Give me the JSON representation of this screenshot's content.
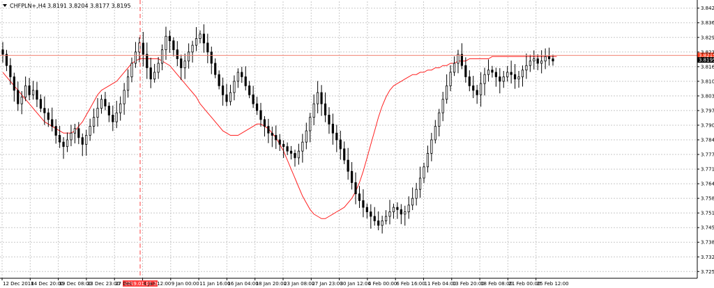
{
  "header": {
    "symbol": "CHFPLN+,H4",
    "ohlc": "3.8191 3.8204 3.8177 3.8195"
  },
  "colors": {
    "background": "#ffffff",
    "grid": "#c8c8c8",
    "candle": "#000000",
    "ma_line": "#ff2020",
    "level_line": "#f08070",
    "vline": "#ff4040",
    "level_tag": "#ff3a1a",
    "price_tag": "#000000"
  },
  "level_label": "3.8215",
  "current_price_label": "3.8195",
  "cursor_time_label": "2019.01.01 20:00",
  "chart_data": {
    "type": "candlestick",
    "title": "CHFPLN+,H4",
    "grid": true,
    "ylim": [
      3.7225,
      3.8455
    ],
    "y_ticks": [
      "3.8425",
      "3.8360",
      "3.8295",
      "3.8230",
      "3.8165",
      "3.8100",
      "3.8035",
      "3.7970",
      "3.7905",
      "3.7840",
      "3.7775",
      "3.7710",
      "3.7645",
      "3.7580",
      "3.7515",
      "3.7450",
      "3.7385",
      "3.7320",
      "3.7255"
    ],
    "x_ticks": [
      "12 Dec 2018",
      "14 Dec 20:00",
      "19 Dec 08:00",
      "23 Dec 23:00",
      "27 Dec",
      "4 Jan 12:00",
      "9 Jan 00:00",
      "11 Jan 16:00",
      "16 Jan 04:00",
      "18 Jan 20:00",
      "23 Jan 08:00",
      "27 Jan 23:00",
      "30 Jan 12:00",
      "4 Feb 00:00",
      "6 Feb 16:00",
      "11 Feb 04:00",
      "13 Feb 20:00",
      "18 Feb 08:00",
      "21 Feb 00:00",
      "25 Feb 12:00"
    ],
    "horizontal_level": 3.8215,
    "last_price": 3.8195,
    "series": [
      {
        "name": "close",
        "values": [
          3.822,
          3.817,
          3.812,
          3.806,
          3.8,
          3.803,
          3.808,
          3.804,
          3.806,
          3.802,
          3.798,
          3.796,
          3.793,
          3.79,
          3.786,
          3.783,
          3.781,
          3.784,
          3.787,
          3.789,
          3.785,
          3.782,
          3.786,
          3.79,
          3.794,
          3.798,
          3.802,
          3.799,
          3.795,
          3.792,
          3.796,
          3.8,
          3.806,
          3.812,
          3.818,
          3.823,
          3.827,
          3.822,
          3.816,
          3.811,
          3.814,
          3.818,
          3.824,
          3.83,
          3.828,
          3.824,
          3.82,
          3.816,
          3.819,
          3.823,
          3.826,
          3.829,
          3.831,
          3.827,
          3.823,
          3.818,
          3.813,
          3.808,
          3.804,
          3.801,
          3.805,
          3.81,
          3.814,
          3.812,
          3.808,
          3.804,
          3.8,
          3.797,
          3.793,
          3.79,
          3.787,
          3.786,
          3.784,
          3.782,
          3.781,
          3.779,
          3.778,
          3.776,
          3.779,
          3.783,
          3.788,
          3.794,
          3.8,
          3.805,
          3.8,
          3.795,
          3.791,
          3.787,
          3.784,
          3.78,
          3.775,
          3.77,
          3.765,
          3.76,
          3.757,
          3.754,
          3.752,
          3.75,
          3.748,
          3.746,
          3.748,
          3.75,
          3.752,
          3.754,
          3.753,
          3.751,
          3.752,
          3.755,
          3.758,
          3.762,
          3.767,
          3.772,
          3.778,
          3.784,
          3.79,
          3.796,
          3.802,
          3.808,
          3.814,
          3.818,
          3.822,
          3.817,
          3.812,
          3.808,
          3.806,
          3.804,
          3.809,
          3.813,
          3.815,
          3.814,
          3.812,
          3.81,
          3.812,
          3.814,
          3.813,
          3.811,
          3.812,
          3.815,
          3.817,
          3.819,
          3.82,
          3.818,
          3.819,
          3.821,
          3.82,
          3.819
        ]
      },
      {
        "name": "moving_average",
        "values": [
          3.814,
          3.812,
          3.81,
          3.808,
          3.806,
          3.804,
          3.802,
          3.8,
          3.798,
          3.796,
          3.794,
          3.792,
          3.791,
          3.79,
          3.789,
          3.788,
          3.787,
          3.787,
          3.787,
          3.788,
          3.79,
          3.792,
          3.795,
          3.798,
          3.801,
          3.804,
          3.806,
          3.807,
          3.808,
          3.809,
          3.81,
          3.812,
          3.814,
          3.816,
          3.818,
          3.819,
          3.82,
          3.82,
          3.82,
          3.82,
          3.82,
          3.82,
          3.819,
          3.818,
          3.817,
          3.815,
          3.813,
          3.811,
          3.809,
          3.807,
          3.805,
          3.803,
          3.8,
          3.798,
          3.796,
          3.794,
          3.792,
          3.79,
          3.788,
          3.787,
          3.786,
          3.786,
          3.786,
          3.787,
          3.788,
          3.789,
          3.79,
          3.791,
          3.791,
          3.79,
          3.789,
          3.787,
          3.785,
          3.782,
          3.779,
          3.775,
          3.771,
          3.767,
          3.763,
          3.759,
          3.756,
          3.753,
          3.751,
          3.75,
          3.749,
          3.749,
          3.75,
          3.751,
          3.752,
          3.753,
          3.754,
          3.756,
          3.758,
          3.761,
          3.765,
          3.77,
          3.776,
          3.782,
          3.788,
          3.794,
          3.799,
          3.803,
          3.806,
          3.808,
          3.809,
          3.81,
          3.811,
          3.812,
          3.813,
          3.813,
          3.814,
          3.814,
          3.815,
          3.815,
          3.816,
          3.816,
          3.817,
          3.817,
          3.818,
          3.818,
          3.819,
          3.819,
          3.819,
          3.82,
          3.82,
          3.82,
          3.82,
          3.82,
          3.82,
          3.821,
          3.821,
          3.821,
          3.821,
          3.821,
          3.821,
          3.821,
          3.821,
          3.821,
          3.821,
          3.821,
          3.821,
          3.821,
          3.821,
          3.821,
          3.821,
          3.821,
          3.821
        ]
      }
    ]
  }
}
